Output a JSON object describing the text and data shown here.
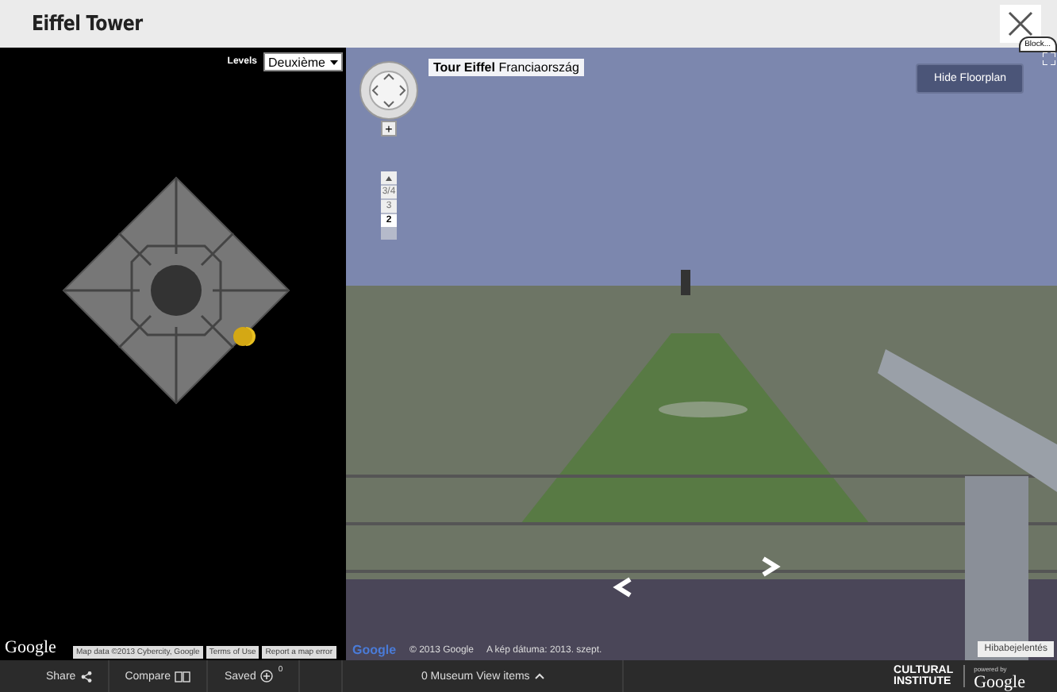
{
  "window": {
    "title": "Eiffel Tower"
  },
  "floorplan": {
    "levels_label": "Levels",
    "level_value": "Deuxième",
    "logo": "Google",
    "attribution": "Map data ©2013 Cybercity, Google",
    "links": [
      "Terms of Use",
      "Report a map error"
    ]
  },
  "street_view": {
    "place_name": "Tour Eiffel",
    "place_country": "Franciaország",
    "zoom_in": "+",
    "levels": [
      {
        "label": "3/4",
        "selected": false
      },
      {
        "label": "3",
        "selected": false
      },
      {
        "label": "2",
        "selected": true
      }
    ],
    "hide_button": "Hide Floorplan",
    "block_tag": "Block...",
    "logo": "Google",
    "copyright": "© 2013 Google",
    "image_date": "A kép dátuma: 2013. szept.",
    "report": "Hibabejelentés"
  },
  "footer": {
    "share": "Share",
    "compare": "Compare",
    "saved": "Saved",
    "saved_count": "0",
    "museum_items": "0 Museum View items",
    "brand_line1": "CULTURAL",
    "brand_line2": "INSTITUTE",
    "powered_by": "powered by",
    "powered_logo": "Google"
  }
}
